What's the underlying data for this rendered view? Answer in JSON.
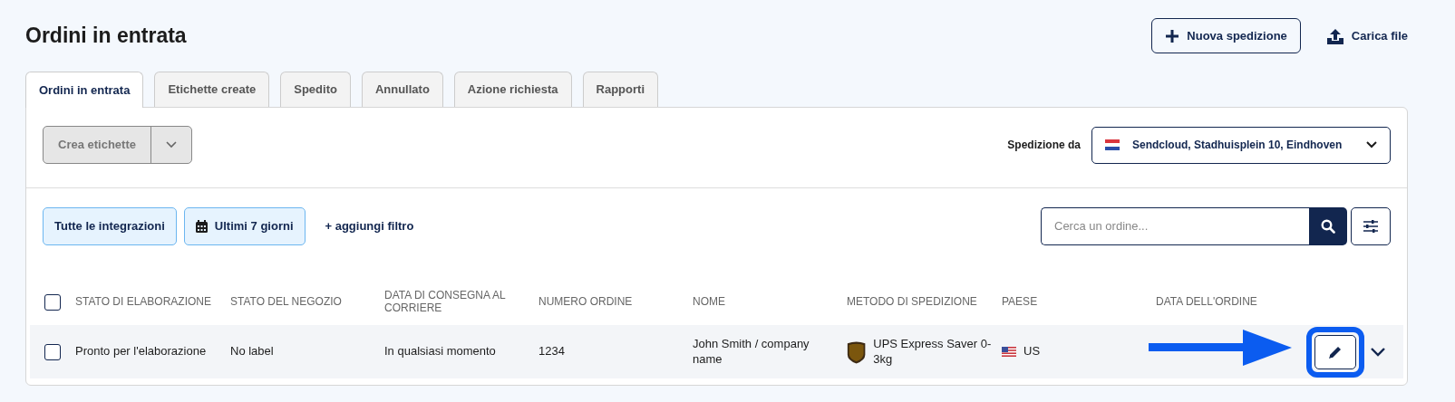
{
  "page_title": "Ordini in entrata",
  "header_actions": [
    {
      "kind": "outline",
      "label": "Nuova spedizione"
    },
    {
      "kind": "link",
      "label": "Carica file"
    }
  ],
  "tabs": [
    {
      "label": "Ordini in entrata",
      "selected": true
    },
    {
      "label": "Etichette create",
      "selected": false
    },
    {
      "label": "Spedito",
      "selected": false
    },
    {
      "label": "Annullato",
      "selected": false
    },
    {
      "label": "Azione richiesta",
      "selected": false
    },
    {
      "label": "Rapporti",
      "selected": false
    }
  ],
  "bulk_action": {
    "label": "Crea etichette",
    "disabled": true
  },
  "ship_from": {
    "label": "Spedizione da",
    "value": "Sendcloud, Stadhuisplein 10, Eindhoven"
  },
  "filters": [
    {
      "kind": "chip",
      "label": "Tutte le integrazioni"
    },
    {
      "kind": "date",
      "label": "Ultimi 7 giorni"
    },
    {
      "kind": "link",
      "label": "+ aggiungi filtro"
    }
  ],
  "search": {
    "placeholder": "Cerca un ordine..."
  },
  "table": {
    "select_all_checked": false,
    "columns": [
      "STATO DI ELABORAZIONE",
      "STATO DEL NEGOZIO",
      "DATA DI CONSEGNA AL CORRIERE",
      "NUMERO ORDINE",
      "NOME",
      "METODO DI SPEDIZIONE",
      "PAESE",
      "DATA DELL'ORDINE"
    ],
    "rows": [
      {
        "checked": false,
        "cells": [
          "Pronto per l'elaborazione",
          "No label",
          "In qualsiasi momento",
          "1234",
          "John Smith / company name",
          "UPS Express Saver 0-3kg",
          "US"
        ]
      }
    ]
  }
}
